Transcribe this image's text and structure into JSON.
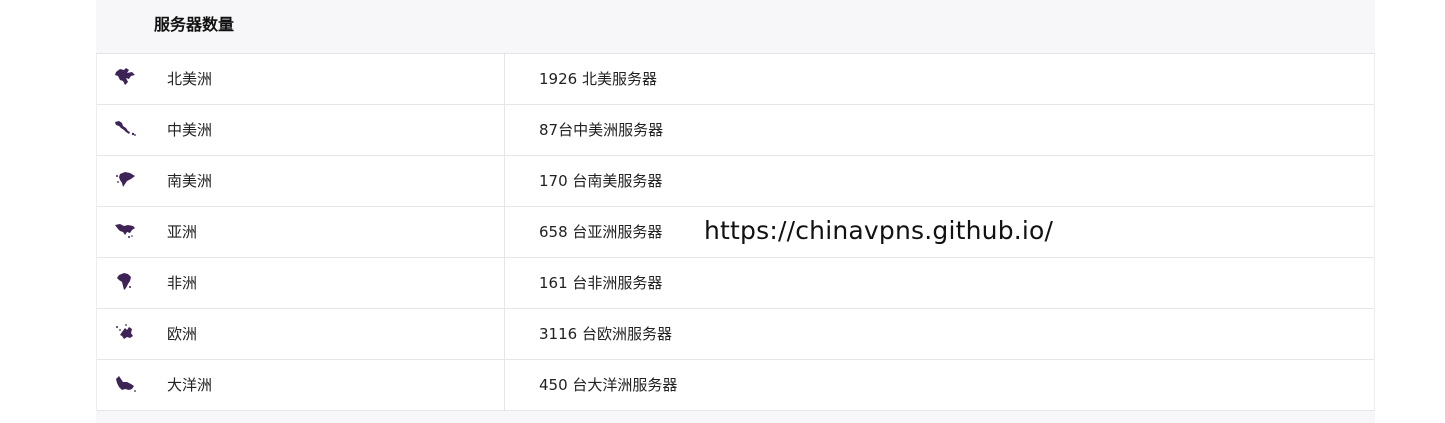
{
  "table": {
    "header": "服务器数量",
    "rows": [
      {
        "icon": "north-america-icon",
        "region": "北美洲",
        "count": "1926 北美服务器"
      },
      {
        "icon": "central-america-icon",
        "region": "中美洲",
        "count": "87台中美洲服务器"
      },
      {
        "icon": "south-america-icon",
        "region": "南美洲",
        "count": "170 台南美服务器"
      },
      {
        "icon": "asia-icon",
        "region": "亚洲",
        "count": "658 台亚洲服务器"
      },
      {
        "icon": "africa-icon",
        "region": "非洲",
        "count": "161 台非洲服务器"
      },
      {
        "icon": "europe-icon",
        "region": "欧洲",
        "count": "3116 台欧洲服务器"
      },
      {
        "icon": "oceania-icon",
        "region": "大洋洲",
        "count": "450 台大洋洲服务器"
      }
    ]
  },
  "watermark": "https://chinavpns.github.io/",
  "colors": {
    "icon": "#3e2456",
    "panel_bg": "#f7f7f9",
    "border": "#e6e6ea"
  }
}
